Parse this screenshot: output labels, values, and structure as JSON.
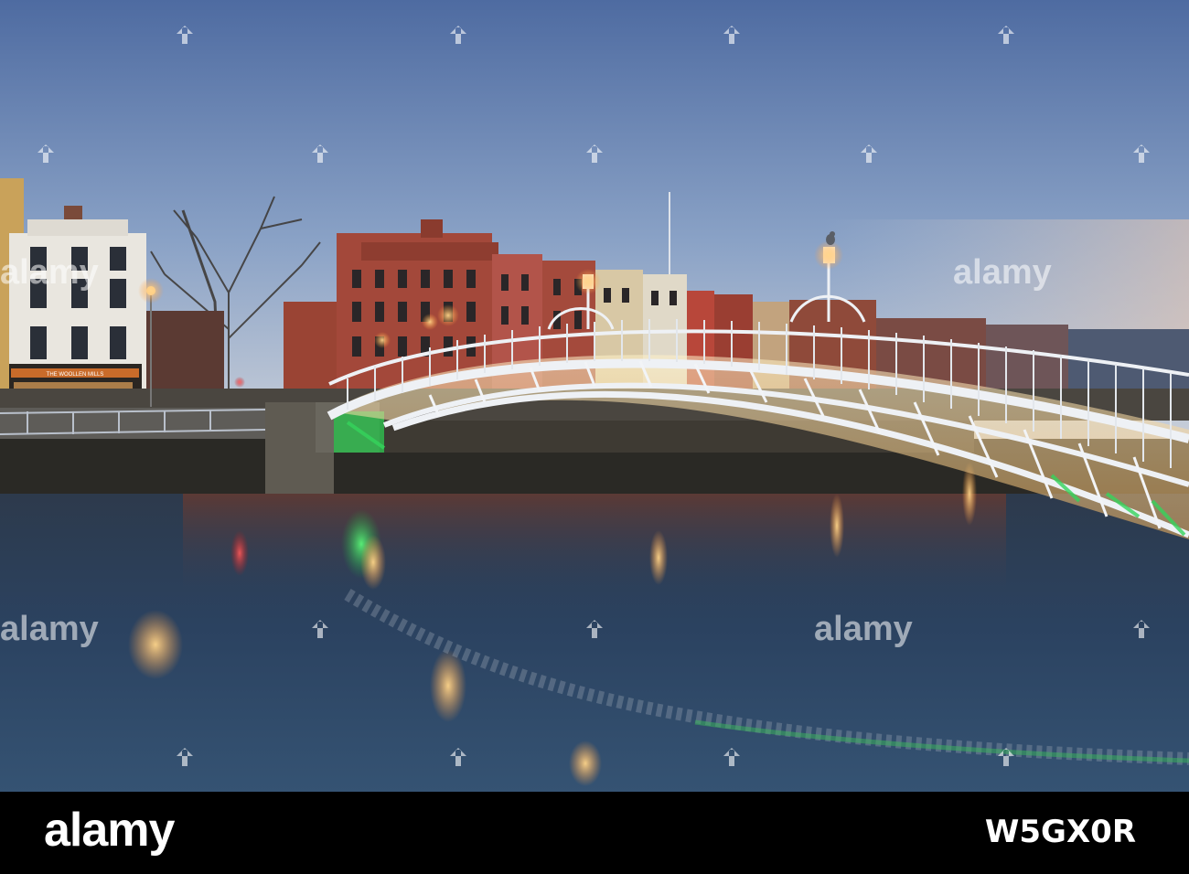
{
  "photo": {
    "subject": "Ha'penny Bridge over the River Liffey at dusk",
    "shop_sign": "THE WOOLLEN MILLS"
  },
  "watermark": {
    "brand": "alamy"
  },
  "footer": {
    "logo": "alamy",
    "image_id": "W5GX0R"
  },
  "colors": {
    "sky_top": "#4d6aa0",
    "sky_bottom": "#bcc9dc",
    "water": "#2a3d57",
    "bridge": "#e6e9ee",
    "bridge_light_green": "#37d35a",
    "brick": "#8a3b2e",
    "footer_bg": "#000000"
  },
  "icons": [
    "alamy-watermark-icon"
  ]
}
